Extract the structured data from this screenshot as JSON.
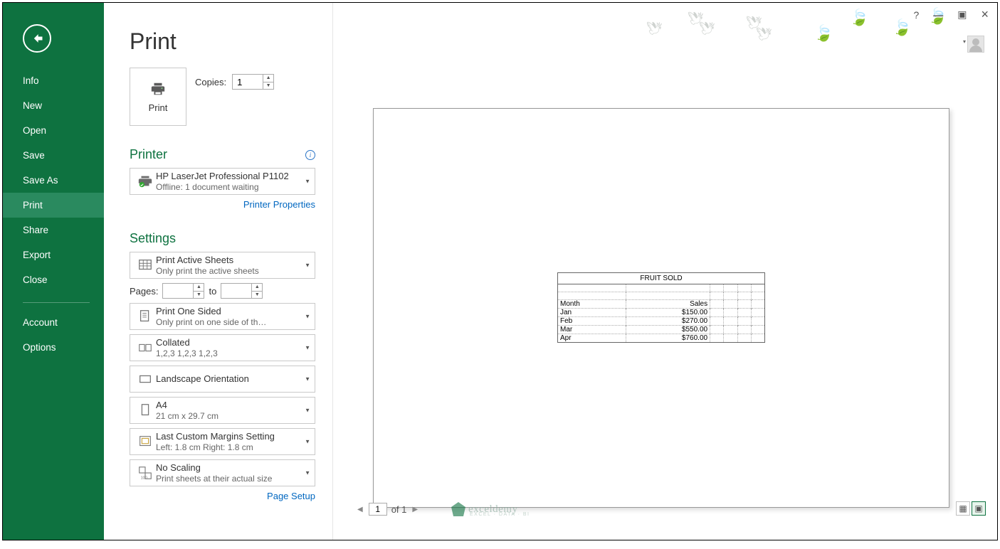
{
  "page_title": "Print",
  "sidebar": {
    "items": [
      "Info",
      "New",
      "Open",
      "Save",
      "Save As",
      "Print",
      "Share",
      "Export",
      "Close"
    ],
    "secondary": [
      "Account",
      "Options"
    ],
    "active_index": 5
  },
  "print_button_label": "Print",
  "copies": {
    "label": "Copies:",
    "value": "1"
  },
  "printer_section": {
    "heading": "Printer",
    "name": "HP LaserJet Professional P1102",
    "status": "Offline: 1 document waiting",
    "properties_link": "Printer Properties"
  },
  "settings_section": {
    "heading": "Settings"
  },
  "settings_options": [
    {
      "title": "Print Active Sheets",
      "sub": "Only print the active sheets",
      "icon": "sheets-icon"
    },
    {
      "title": "Print One Sided",
      "sub": "Only print on one side of th…",
      "icon": "onesided-icon"
    },
    {
      "title": "Collated",
      "sub": "1,2,3    1,2,3    1,2,3",
      "icon": "collated-icon"
    },
    {
      "title": "Landscape Orientation",
      "sub": "",
      "icon": "orientation-icon"
    },
    {
      "title": "A4",
      "sub": "21 cm x 29.7 cm",
      "icon": "papersize-icon"
    },
    {
      "title": "Last Custom Margins Setting",
      "sub": "Left:  1.8 cm    Right:  1.8 cm",
      "icon": "margins-icon"
    },
    {
      "title": "No Scaling",
      "sub": "Print sheets at their actual size",
      "icon": "scaling-icon"
    }
  ],
  "pages_row": {
    "label": "Pages:",
    "to": "to",
    "from_value": "",
    "to_value": ""
  },
  "page_setup_link": "Page Setup",
  "preview_nav": {
    "current": "1",
    "total": "of 1"
  },
  "watermark": {
    "text": "exceldemy",
    "sub": "EXCEL · DATA · BI"
  },
  "preview_sheet": {
    "title": "FRUIT SOLD",
    "headers": [
      "Month",
      "Sales"
    ],
    "rows": [
      [
        "Jan",
        "$150.00"
      ],
      [
        "Feb",
        "$270.00"
      ],
      [
        "Mar",
        "$550.00"
      ],
      [
        "Apr",
        "$760.00"
      ]
    ]
  }
}
